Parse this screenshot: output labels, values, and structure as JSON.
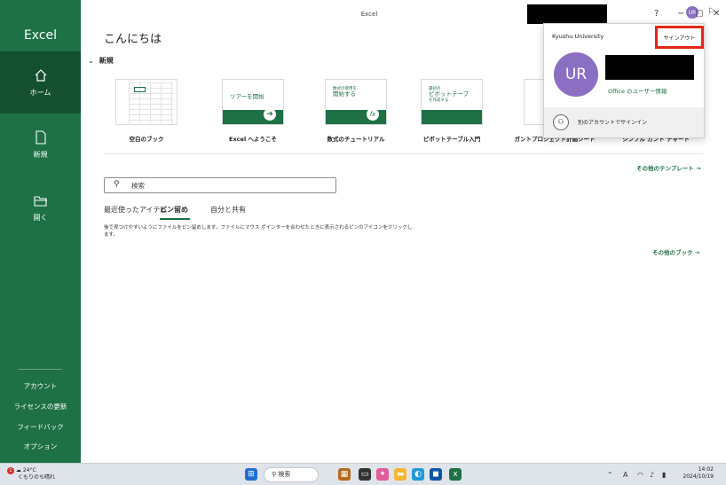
{
  "app": {
    "title": "Excel",
    "avatar_initials": "UR"
  },
  "sidebar": {
    "title": "Excel",
    "nav": [
      {
        "label": "ホーム",
        "icon": "home-icon"
      },
      {
        "label": "新規",
        "icon": "new-file-icon"
      },
      {
        "label": "開く",
        "icon": "folder-open-icon"
      }
    ],
    "footer": [
      "アカウント",
      "ライセンスの更新",
      "フィードバック",
      "オプション"
    ]
  },
  "main": {
    "greeting": "こんにちは",
    "new_section": "新規",
    "templates": [
      {
        "name": "空白のブック"
      },
      {
        "name": "Excel へようこそ",
        "thumb_text": "ツアーを開始"
      },
      {
        "name": "数式のチュートリアル",
        "thumb_text_small": "数式の使用を",
        "thumb_text": "開始する"
      },
      {
        "name": "ピボットテーブル入門",
        "thumb_text_small": "最初の",
        "thumb_text": "ピボットテーブ",
        "thumb_text_extra": "を作成する"
      },
      {
        "name": "ガントプロジェクト計画シート"
      },
      {
        "name": "シンプル ガント チャート"
      }
    ],
    "more_templates": "その他のテンプレート →",
    "search_placeholder": "検索",
    "tabs": [
      "最近使ったアイテム",
      "ピン留め",
      "自分と共有"
    ],
    "pinned_hint": "後で見つけやすいようにファイルをピン留めします。ファイルにマウス ポインターを合わせたときに表示されるピンのアイコンをクリックします。",
    "more_books": "その他のブック →"
  },
  "account_popup": {
    "org": "Kyushu University",
    "signout": "サインアウト",
    "initials": "UR",
    "profile_link": "Office のユーザー情報",
    "switch_account": "別のアカウントでサインイン"
  },
  "titlebar": {
    "minimize": "−",
    "maximize": "▢",
    "close": "✕",
    "help": "?"
  },
  "taskbar": {
    "weather_temp": "24°C",
    "weather_desc": "くもりのち晴れ",
    "weather_badge": "1",
    "search": "検索",
    "ime": "A",
    "time": "14:02",
    "date": "2024/10/19"
  },
  "colors": {
    "brand": "#1e7145",
    "accent_red": "#e3261c",
    "avatar": "#8a6fc2"
  }
}
